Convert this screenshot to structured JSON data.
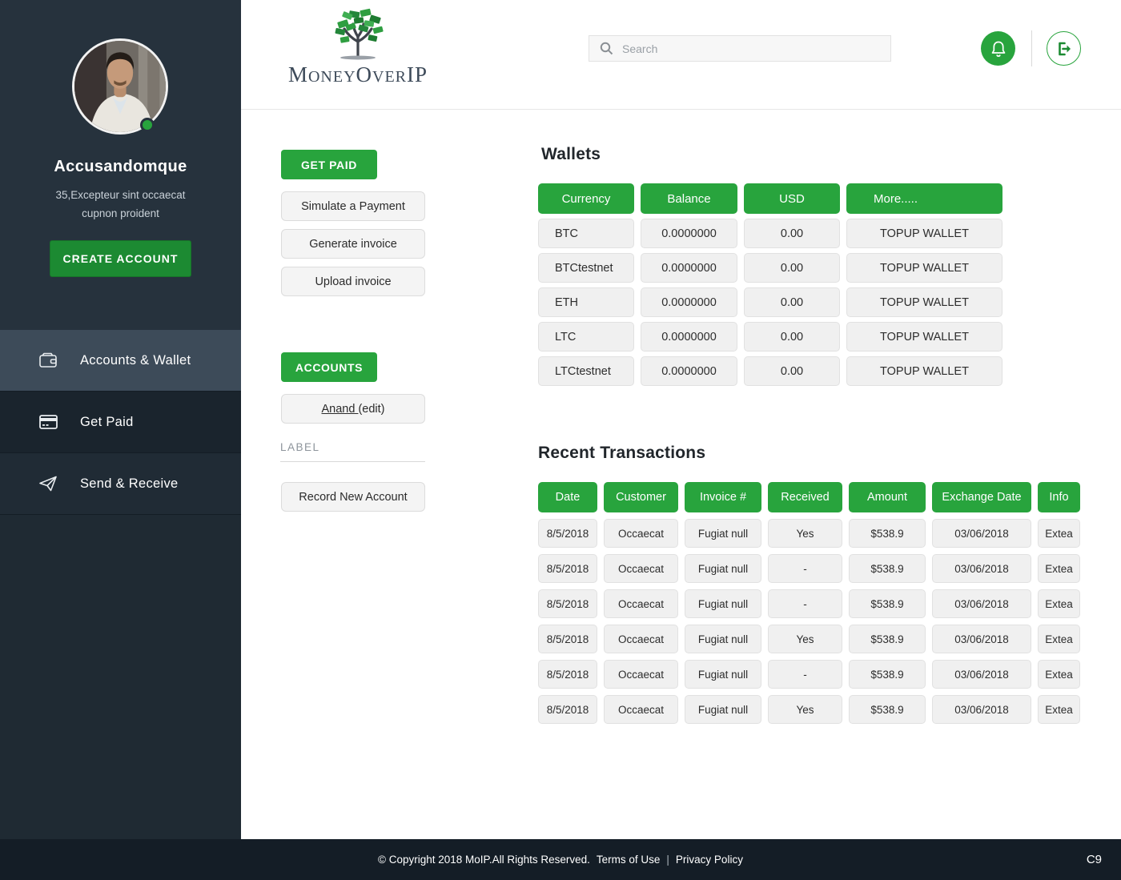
{
  "app": {
    "logo_parts": [
      "M",
      "ONEY",
      "O",
      "VER",
      "IP"
    ],
    "accent_green": "#28a43d",
    "dark_green": "#1c8a32",
    "sidebar_dark": "#26323d",
    "footer_dark": "#141d26"
  },
  "header": {
    "search_placeholder": "Search"
  },
  "sidebar": {
    "name": "Accusandomque",
    "subtitle_line1": "35,Excepteur sint occaecat",
    "subtitle_line2": "cupnon proident",
    "create_account_label": "CREATE ACCOUNT",
    "items": [
      {
        "label": "Accounts & Wallet",
        "icon": "wallet-icon"
      },
      {
        "label": "Get Paid",
        "icon": "credit-card-icon"
      },
      {
        "label": "Send & Receive",
        "icon": "paper-plane-icon"
      }
    ]
  },
  "actions": {
    "get_paid_label": "GET PAID",
    "simulate_label": "Simulate a Payment",
    "generate_label": "Generate invoice",
    "upload_label": "Upload invoice",
    "accounts_label": "ACCOUNTS",
    "account_name": "Anand ",
    "account_edit": "(edit)",
    "label_caption": "LABEL",
    "record_label": "Record New Account"
  },
  "wallets": {
    "title": "Wallets",
    "headers": [
      "Currency",
      "Balance",
      "USD",
      "More....."
    ],
    "rows": [
      {
        "currency": "BTC",
        "balance": "0.0000000",
        "usd": "0.00",
        "more": "TOPUP WALLET"
      },
      {
        "currency": "BTCtestnet",
        "balance": "0.0000000",
        "usd": "0.00",
        "more": "TOPUP WALLET"
      },
      {
        "currency": "ETH",
        "balance": "0.0000000",
        "usd": "0.00",
        "more": "TOPUP WALLET"
      },
      {
        "currency": "LTC",
        "balance": "0.0000000",
        "usd": "0.00",
        "more": "TOPUP WALLET"
      },
      {
        "currency": "LTCtestnet",
        "balance": "0.0000000",
        "usd": "0.00",
        "more": "TOPUP WALLET"
      }
    ]
  },
  "transactions": {
    "title": "Recent Transactions",
    "headers": [
      "Date",
      "Customer",
      "Invoice #",
      "Received",
      "Amount",
      "Exchange Date",
      "Info"
    ],
    "rows": [
      {
        "date": "8/5/2018",
        "customer": "Occaecat",
        "invoice": "Fugiat null",
        "received": "Yes",
        "amount": "$538.9",
        "exchange_date": "03/06/2018",
        "info": "Extea"
      },
      {
        "date": "8/5/2018",
        "customer": "Occaecat",
        "invoice": "Fugiat null",
        "received": "-",
        "amount": "$538.9",
        "exchange_date": "03/06/2018",
        "info": "Extea"
      },
      {
        "date": "8/5/2018",
        "customer": "Occaecat",
        "invoice": "Fugiat null",
        "received": "-",
        "amount": "$538.9",
        "exchange_date": "03/06/2018",
        "info": "Extea"
      },
      {
        "date": "8/5/2018",
        "customer": "Occaecat",
        "invoice": "Fugiat null",
        "received": "Yes",
        "amount": "$538.9",
        "exchange_date": "03/06/2018",
        "info": "Extea"
      },
      {
        "date": "8/5/2018",
        "customer": "Occaecat",
        "invoice": "Fugiat null",
        "received": "-",
        "amount": "$538.9",
        "exchange_date": "03/06/2018",
        "info": "Extea"
      },
      {
        "date": "8/5/2018",
        "customer": "Occaecat",
        "invoice": "Fugiat null",
        "received": "Yes",
        "amount": "$538.9",
        "exchange_date": "03/06/2018",
        "info": "Extea"
      }
    ]
  },
  "footer": {
    "copyright": "© Copyright 2018 MoIP.All Rights Reserved.",
    "terms": "Terms of Use",
    "separator": "|",
    "privacy": "Privacy Policy",
    "version": "C9"
  }
}
